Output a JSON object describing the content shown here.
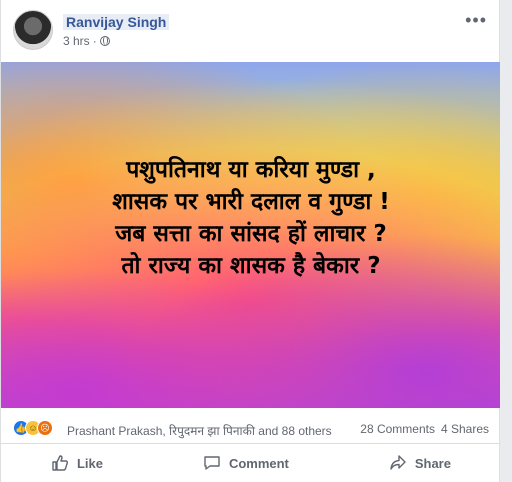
{
  "post": {
    "author": "Ranvijay Singh",
    "time": "3 hrs",
    "time_separator": "·",
    "more_icon": "ellipsis-icon",
    "privacy_icon": "globe-icon"
  },
  "image_text": {
    "line1": "पशुपतिनाथ या करिया मुण्डा ,",
    "line2": "शासक पर भारी दलाल व गुण्डा !",
    "line3": "जब सत्ता का सांसद हों लाचार ?",
    "line4": "तो राज्य का शासक है बेकार ?"
  },
  "reactions": {
    "icons": [
      "like-reaction-icon",
      "haha-reaction-icon",
      "angry-reaction-icon"
    ],
    "names": "Prashant Prakash, रिपुदमन झा पिनाकी and 88 others",
    "comments": "28 Comments",
    "shares": "4 Shares"
  },
  "actions": {
    "like": "Like",
    "comment": "Comment",
    "share": "Share"
  },
  "colors": {
    "author": "#365899",
    "meta": "#616770",
    "like_blue": "#1877f2"
  }
}
